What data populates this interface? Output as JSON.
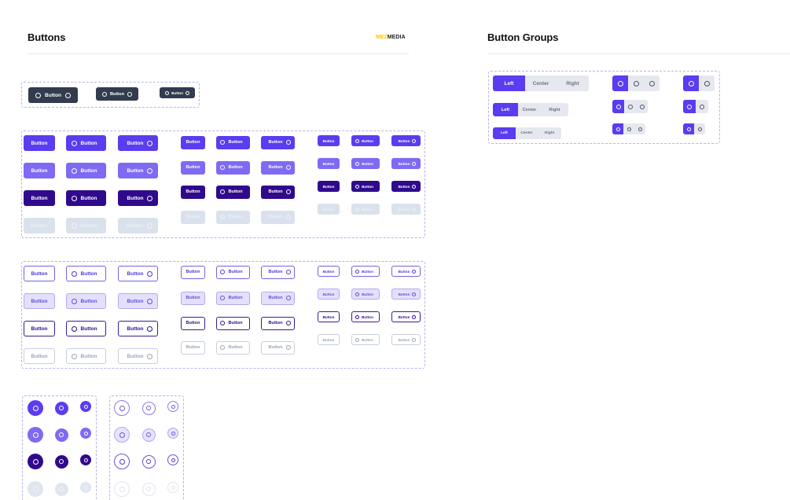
{
  "headings": {
    "buttons": "Buttons",
    "button_groups": "Button Groups"
  },
  "logo": {
    "part1": "ME2",
    "part2": "MEDIA"
  },
  "button_label": "Button",
  "group_labels": [
    "Left",
    "Center",
    "Right"
  ],
  "colors": {
    "primary": "#5b3cf0",
    "primary_light": "#7e6af3",
    "primary_dark": "#300a8c",
    "disabled": "#d9e2ec",
    "dark": "#323c4e",
    "panel_border": "#b8b3f0"
  },
  "icons": {
    "button_icon": "circle-icon"
  }
}
